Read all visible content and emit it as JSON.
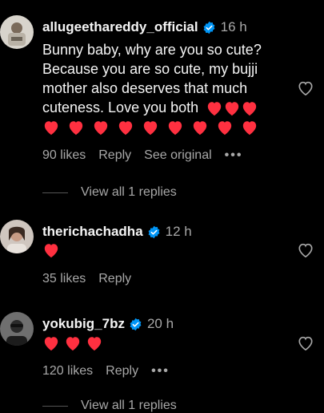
{
  "comments": [
    {
      "username": "allugeethareddy_official",
      "verified": true,
      "time": "16 h",
      "text": "Bunny baby, why are you so cute? Because you are so cute, my bujji mother also deserves that much cuteness. Love you both",
      "hearts_inline": 3,
      "hearts_line": 9,
      "likes": "90 likes",
      "reply": "Reply",
      "see_original": "See original",
      "view_replies": "View all 1 replies"
    },
    {
      "username": "therichachadha",
      "verified": true,
      "time": "12 h",
      "hearts_line": 1,
      "likes": "35 likes",
      "reply": "Reply"
    },
    {
      "username": "yokubig_7bz",
      "verified": true,
      "time": "20 h",
      "hearts_line": 3,
      "likes": "120 likes",
      "reply": "Reply",
      "view_replies": "View all 1 replies"
    }
  ],
  "colors": {
    "background": "#000000",
    "text": "#f5f5f5",
    "secondary": "#a8a8a8",
    "heart": "#ff3040",
    "verified": "#0095f6"
  },
  "icons": {
    "verified": "verified-badge-icon",
    "like": "heart-outline-icon",
    "more": "more-options-icon",
    "heart_emoji": "red-heart-emoji"
  }
}
